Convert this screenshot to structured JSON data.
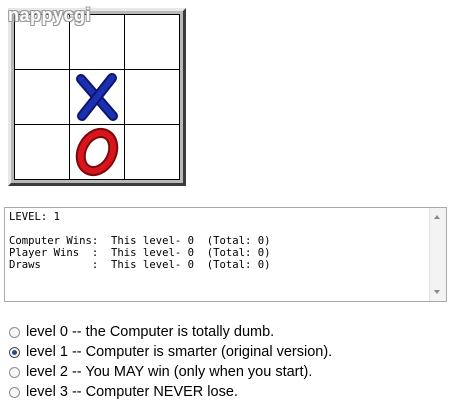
{
  "logo": {
    "text": "nappycgi"
  },
  "board": {
    "cells": [
      "",
      "",
      "",
      "",
      "X",
      "",
      "",
      "O",
      ""
    ],
    "x_color": "#1c2fb0",
    "o_color": "#d8141c"
  },
  "status": {
    "text": "LEVEL: 1\n\nComputer Wins:  This level- 0  (Total: 0)\nPlayer Wins  :  This level- 0  (Total: 0)\nDraws        :  This level- 0  (Total: 0)"
  },
  "levels": {
    "selected": 1,
    "options": [
      {
        "label": "level 0 -- the Computer is totally dumb."
      },
      {
        "label": "level 1 -- Computer is smarter (original version)."
      },
      {
        "label": "level 2 -- You MAY win (only when you start)."
      },
      {
        "label": "level 3 -- Computer NEVER lose."
      }
    ]
  }
}
